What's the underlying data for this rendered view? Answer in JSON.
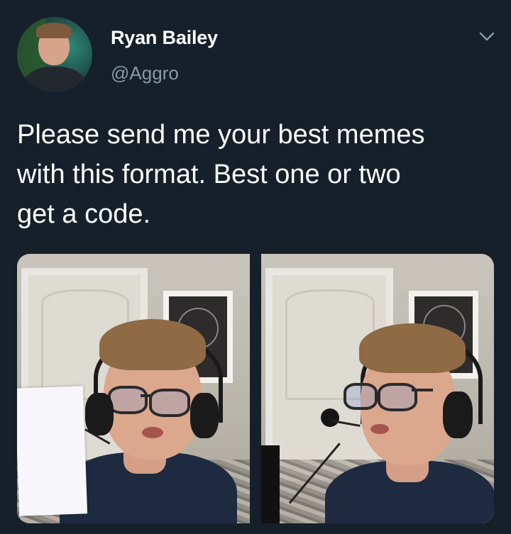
{
  "tweet": {
    "author": {
      "name": "Ryan Bailey",
      "handle": "@Aggro"
    },
    "text": "Please send me your best memes\nwith this format. Best one or two\nget a code.",
    "media": [
      {
        "kind": "photo"
      },
      {
        "kind": "photo"
      }
    ]
  },
  "icons": {
    "menu": "chevron-down-icon"
  },
  "colors": {
    "background": "#15202b",
    "primary_text": "#ffffff",
    "secondary_text": "#8899a6"
  }
}
